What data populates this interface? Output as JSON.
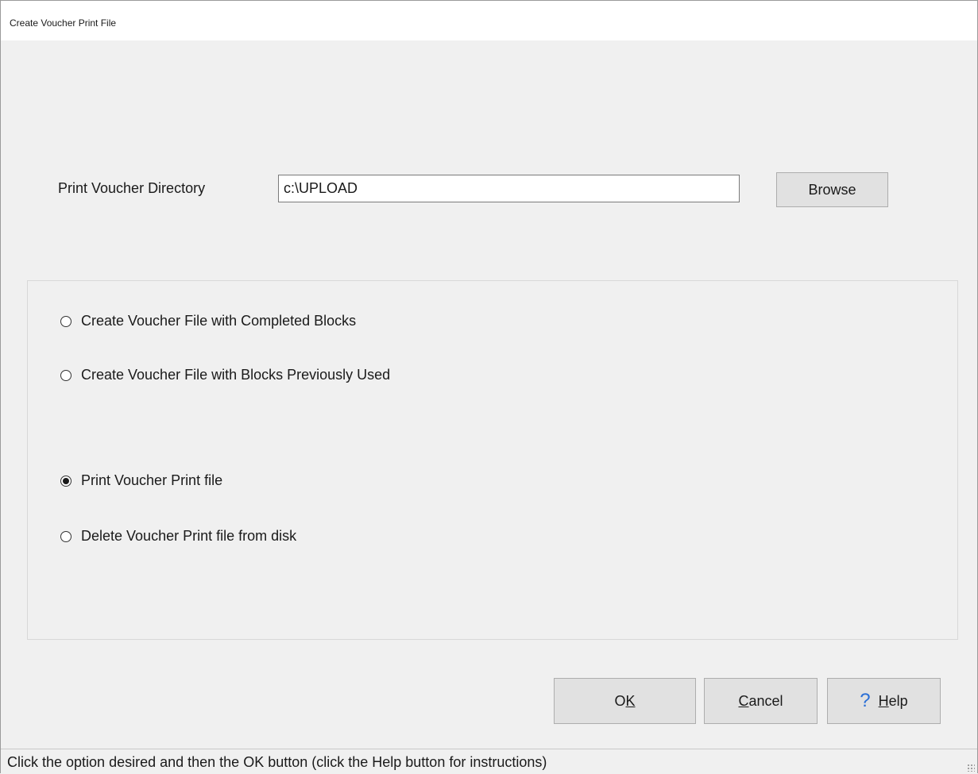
{
  "window": {
    "title": "Create Voucher Print File"
  },
  "directory": {
    "label": "Print Voucher Directory",
    "value": "c:\\UPLOAD",
    "browse_label": "Browse"
  },
  "options": [
    {
      "label": "Create Voucher File with Completed Blocks",
      "checked": false
    },
    {
      "label": "Create Voucher File with Blocks Previously Used",
      "checked": false
    },
    {
      "label": "Print Voucher Print file",
      "checked": true
    },
    {
      "label": "Delete Voucher Print file from disk",
      "checked": false
    }
  ],
  "buttons": {
    "ok_prefix": "O",
    "ok_accel": "K",
    "cancel_accel": "C",
    "cancel_rest": "ancel",
    "help_icon": "?",
    "help_accel": "H",
    "help_rest": "elp"
  },
  "status": {
    "text": "Click the option desired and then the OK button (click the Help button for instructions)"
  }
}
